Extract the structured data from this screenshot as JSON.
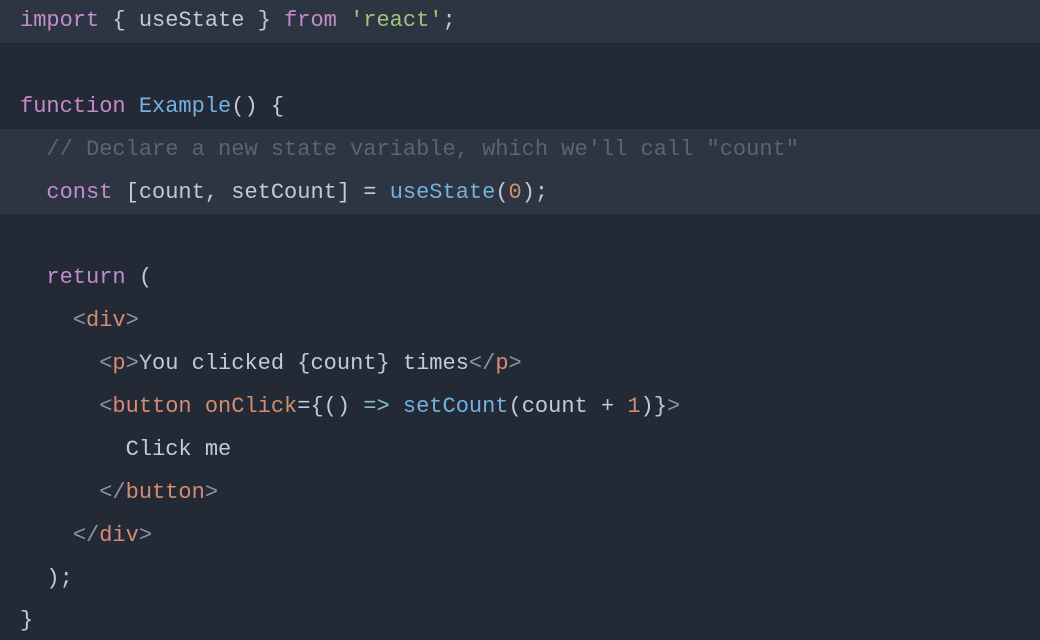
{
  "code": {
    "line1": {
      "import": "import",
      "sp1": " ",
      "brace_o": "{",
      "sp2": " ",
      "useState": "useState",
      "sp3": " ",
      "brace_c": "}",
      "sp4": " ",
      "from": "from",
      "sp5": " ",
      "react": "'react'",
      "semi": ";"
    },
    "line3": {
      "function": "function",
      "sp1": " ",
      "name": "Example",
      "parens": "()",
      "sp2": " ",
      "brace": "{"
    },
    "line4": {
      "indent": "  ",
      "comment": "// Declare a new state variable, which we'll call \"count\""
    },
    "line5": {
      "indent": "  ",
      "const": "const",
      "sp1": " ",
      "br_o": "[",
      "count": "count",
      "comma": ",",
      "sp2": " ",
      "setCount": "setCount",
      "br_c": "]",
      "sp3": " ",
      "eq": "=",
      "sp4": " ",
      "call": "useState",
      "p_o": "(",
      "zero": "0",
      "p_c": ")",
      "semi": ";"
    },
    "line7": {
      "indent": "  ",
      "return": "return",
      "sp1": " ",
      "paren": "("
    },
    "line8": {
      "indent": "    ",
      "lt": "<",
      "tag": "div",
      "gt": ">"
    },
    "line9": {
      "indent": "      ",
      "lt": "<",
      "tag": "p",
      "gt": ">",
      "txt1": "You clicked ",
      "br_o": "{",
      "var": "count",
      "br_c": "}",
      "txt2": " times",
      "lt2": "</",
      "tag2": "p",
      "gt2": ">"
    },
    "line10": {
      "indent": "      ",
      "lt": "<",
      "tag": "button",
      "sp1": " ",
      "attr": "onClick",
      "eq": "=",
      "br_o": "{",
      "arrow_p": "()",
      "sp2": " ",
      "arrow": "=>",
      "sp3": " ",
      "call": "setCount",
      "p_o": "(",
      "var": "count",
      "sp4": " ",
      "plus": "+",
      "sp5": " ",
      "one": "1",
      "p_c": ")",
      "br_c": "}",
      "gt": ">"
    },
    "line11": {
      "indent": "        ",
      "txt": "Click me"
    },
    "line12": {
      "indent": "      ",
      "lt": "</",
      "tag": "button",
      "gt": ">"
    },
    "line13": {
      "indent": "    ",
      "lt": "</",
      "tag": "div",
      "gt": ">"
    },
    "line14": {
      "indent": "  ",
      "paren": ")",
      "semi": ";"
    },
    "line15": {
      "brace": "}"
    }
  }
}
